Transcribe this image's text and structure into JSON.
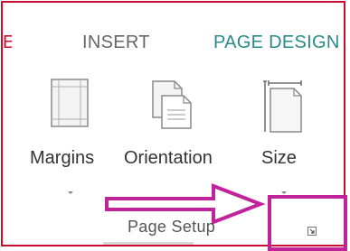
{
  "ribbon": {
    "tabs": [
      {
        "label": "E"
      },
      {
        "label": "INSERT"
      },
      {
        "label": "PAGE DESIGN"
      }
    ],
    "buttons": {
      "margins": "Margins",
      "orientation": "Orientation",
      "size": "Size"
    },
    "group_label": "Page Setup"
  },
  "colors": {
    "active_tab": "#2a8a88",
    "annotation": "#c0239a",
    "border": "#c8102e"
  },
  "icons": [
    "margins-icon",
    "orientation-icon",
    "size-icon",
    "dialog-launcher-icon",
    "arrow-annotation"
  ]
}
